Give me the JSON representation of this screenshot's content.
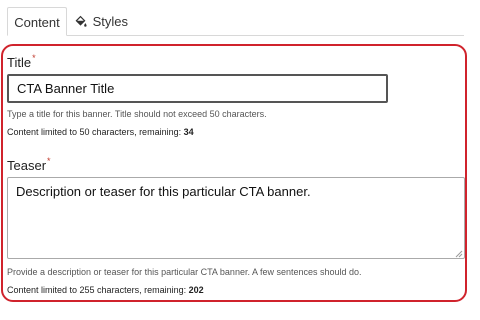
{
  "tabs": [
    {
      "label": "Content",
      "active": true
    },
    {
      "label": "Styles",
      "active": false,
      "icon": "paint-bucket-icon"
    }
  ],
  "title_field": {
    "label": "Title",
    "required_marker": "*",
    "value": "CTA Banner Title",
    "help": "Type a title for this banner. Title should not exceed 50 characters.",
    "limit_text": "Content limited to 50 characters, remaining: ",
    "remaining": "34"
  },
  "teaser_field": {
    "label": "Teaser",
    "required_marker": "*",
    "value": "Description or teaser for this particular CTA banner.",
    "help": "Provide a description or teaser for this particular CTA banner. A few sentences should do.",
    "limit_text": "Content limited to 255 characters, remaining: ",
    "remaining": "202"
  },
  "colors": {
    "highlight_border": "#d0232c",
    "required": "#c0392b"
  }
}
